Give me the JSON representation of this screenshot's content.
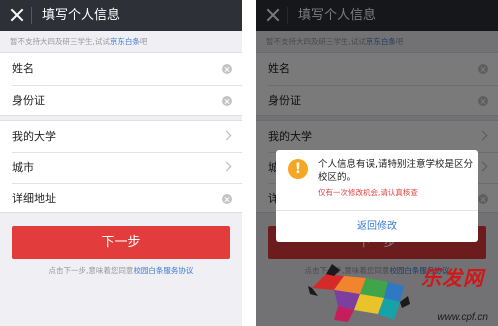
{
  "header": {
    "title": "填写个人信息"
  },
  "notice": {
    "prefix": "暂不支持大四及研三学生,试试",
    "link": "京东白条",
    "suffix": "吧"
  },
  "form": {
    "group1": [
      {
        "label": "姓名",
        "control": "clear"
      },
      {
        "label": "身份证",
        "control": "clear"
      }
    ],
    "group2": [
      {
        "label": "我的大学",
        "control": "chevron"
      },
      {
        "label": "城市",
        "control": "chevron"
      },
      {
        "label": "详细地址",
        "control": "clear"
      }
    ]
  },
  "next_button": "下一步",
  "agreement": {
    "prefix": "点击下一步,意味着您同意",
    "link": "校园白条服务协议"
  },
  "dialog": {
    "message": "个人信息有误,请特别注意学校是区分校区的。",
    "sub": "仅有一次修改机会,请认真核查",
    "button": "返回修改",
    "icon_glyph": "!"
  },
  "watermark": {
    "text": "乐发网",
    "url": "www.cpf.cn"
  },
  "colors": {
    "header_bg": "#2d3137",
    "primary_red": "#e23c3c",
    "link_blue": "#3b7ad1",
    "warning_orange": "#f5a623"
  }
}
